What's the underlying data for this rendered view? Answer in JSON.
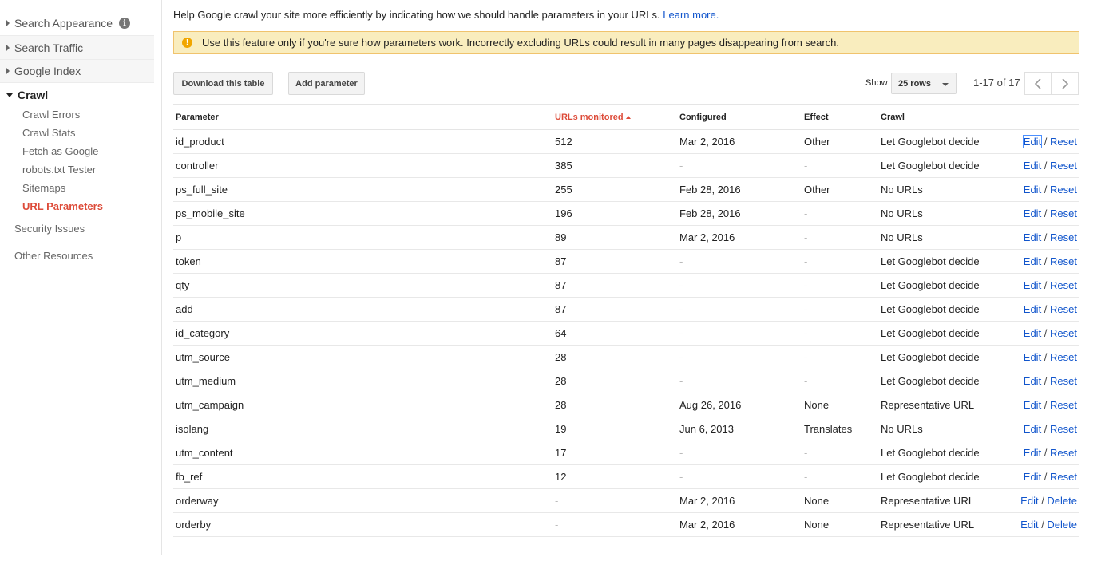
{
  "sidebar": {
    "sections": [
      {
        "label": "Search Appearance",
        "has_info": true
      },
      {
        "label": "Search Traffic"
      },
      {
        "label": "Google Index"
      }
    ],
    "crawl": {
      "label": "Crawl",
      "items": [
        "Crawl Errors",
        "Crawl Stats",
        "Fetch as Google",
        "robots.txt Tester",
        "Sitemaps",
        "URL Parameters"
      ],
      "current": "URL Parameters"
    },
    "other_items": [
      "Security Issues",
      "Other Resources"
    ]
  },
  "intro": {
    "text": "Help Google crawl your site more efficiently by indicating how we should handle parameters in your URLs.",
    "link": "Learn more."
  },
  "warning": {
    "text": "Use this feature only if you're sure how parameters work. Incorrectly excluding URLs could result in many pages disappearing from search."
  },
  "toolbar": {
    "download_label": "Download this table",
    "add_label": "Add parameter",
    "show_label": "Show",
    "rows_value": "25 rows",
    "page_info": "1-17 of 17"
  },
  "table": {
    "headers": {
      "parameter": "Parameter",
      "urls": "URLs monitored",
      "configured": "Configured",
      "effect": "Effect",
      "crawl": "Crawl"
    },
    "rows": [
      {
        "param": "id_product",
        "urls": "512",
        "configured": "Mar 2, 2016",
        "effect": "Other",
        "crawl": "Let Googlebot decide",
        "a1": "Edit",
        "a2": "Reset"
      },
      {
        "param": "controller",
        "urls": "385",
        "configured": "-",
        "effect": "-",
        "crawl": "Let Googlebot decide",
        "a1": "Edit",
        "a2": "Reset"
      },
      {
        "param": "ps_full_site",
        "urls": "255",
        "configured": "Feb 28, 2016",
        "effect": "Other",
        "crawl": "No URLs",
        "a1": "Edit",
        "a2": "Reset"
      },
      {
        "param": "ps_mobile_site",
        "urls": "196",
        "configured": "Feb 28, 2016",
        "effect": "-",
        "crawl": "No URLs",
        "a1": "Edit",
        "a2": "Reset"
      },
      {
        "param": "p",
        "urls": "89",
        "configured": "Mar 2, 2016",
        "effect": "-",
        "crawl": "No URLs",
        "a1": "Edit",
        "a2": "Reset"
      },
      {
        "param": "token",
        "urls": "87",
        "configured": "-",
        "effect": "-",
        "crawl": "Let Googlebot decide",
        "a1": "Edit",
        "a2": "Reset"
      },
      {
        "param": "qty",
        "urls": "87",
        "configured": "-",
        "effect": "-",
        "crawl": "Let Googlebot decide",
        "a1": "Edit",
        "a2": "Reset"
      },
      {
        "param": "add",
        "urls": "87",
        "configured": "-",
        "effect": "-",
        "crawl": "Let Googlebot decide",
        "a1": "Edit",
        "a2": "Reset"
      },
      {
        "param": "id_category",
        "urls": "64",
        "configured": "-",
        "effect": "-",
        "crawl": "Let Googlebot decide",
        "a1": "Edit",
        "a2": "Reset"
      },
      {
        "param": "utm_source",
        "urls": "28",
        "configured": "-",
        "effect": "-",
        "crawl": "Let Googlebot decide",
        "a1": "Edit",
        "a2": "Reset"
      },
      {
        "param": "utm_medium",
        "urls": "28",
        "configured": "-",
        "effect": "-",
        "crawl": "Let Googlebot decide",
        "a1": "Edit",
        "a2": "Reset"
      },
      {
        "param": "utm_campaign",
        "urls": "28",
        "configured": "Aug 26, 2016",
        "effect": "None",
        "crawl": "Representative URL",
        "a1": "Edit",
        "a2": "Reset"
      },
      {
        "param": "isolang",
        "urls": "19",
        "configured": "Jun 6, 2013",
        "effect": "Translates",
        "crawl": "No URLs",
        "a1": "Edit",
        "a2": "Reset"
      },
      {
        "param": "utm_content",
        "urls": "17",
        "configured": "-",
        "effect": "-",
        "crawl": "Let Googlebot decide",
        "a1": "Edit",
        "a2": "Reset"
      },
      {
        "param": "fb_ref",
        "urls": "12",
        "configured": "-",
        "effect": "-",
        "crawl": "Let Googlebot decide",
        "a1": "Edit",
        "a2": "Reset"
      },
      {
        "param": "orderway",
        "urls": "-",
        "configured": "Mar 2, 2016",
        "effect": "None",
        "crawl": "Representative URL",
        "a1": "Edit",
        "a2": "Delete"
      },
      {
        "param": "orderby",
        "urls": "-",
        "configured": "Mar 2, 2016",
        "effect": "None",
        "crawl": "Representative URL",
        "a1": "Edit",
        "a2": "Delete"
      }
    ]
  },
  "colors": {
    "accent_red": "#dd4b39",
    "link_blue": "#1155cc",
    "warning_bg": "#f9edbe"
  },
  "icons": {
    "warning": "warning-icon",
    "info": "info-icon",
    "prev": "chevron-left-icon",
    "next": "chevron-right-icon"
  }
}
